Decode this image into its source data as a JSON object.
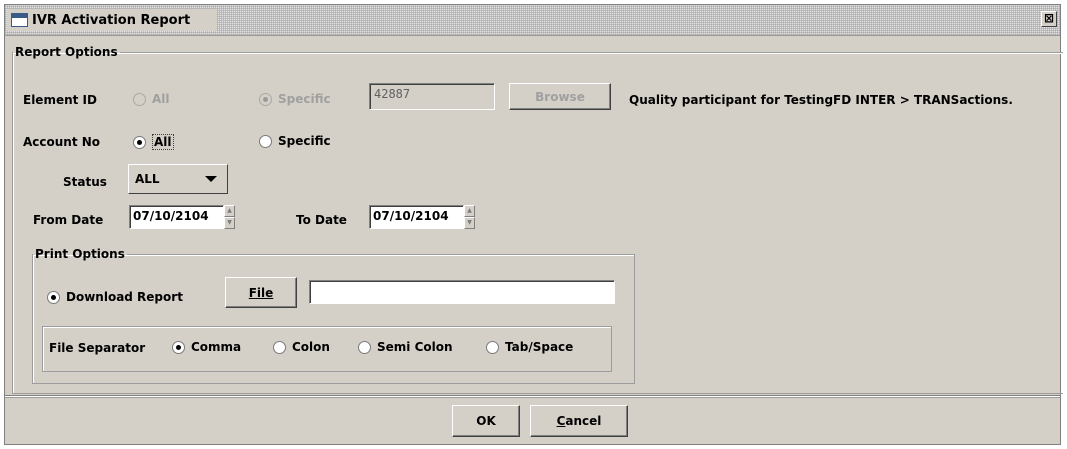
{
  "window": {
    "title": "IVR Activation Report",
    "close_glyph": "⊠"
  },
  "report_options": {
    "legend": "Report Options",
    "element_id": {
      "label": "Element ID",
      "opt_all": "All",
      "opt_specific": "Specific",
      "value": "42887",
      "browse_label": "Browse",
      "description": "Quality participant for TestingFD INTER > TRANSactions."
    },
    "account_no": {
      "label": "Account No",
      "opt_all": "All",
      "opt_specific": "Specific"
    },
    "status": {
      "label": "Status",
      "selected": "ALL"
    },
    "dates": {
      "from_label": "From Date",
      "from_value": "07/10/2104",
      "to_label": "To Date",
      "to_value": "07/10/2104"
    }
  },
  "print_options": {
    "legend": "Print Options",
    "download_label": "Download Report",
    "file_button": "File",
    "file_path": "",
    "file_separator": {
      "label": "File Separator",
      "options": [
        "Comma",
        "Colon",
        "Semi Colon",
        "Tab/Space"
      ]
    }
  },
  "footer": {
    "ok_label": "OK",
    "cancel_label": "Cancel"
  },
  "icons": [
    "window-icon",
    "close-icon",
    "dropdown-arrow-icon",
    "spinner-up-icon",
    "spinner-down-icon"
  ]
}
